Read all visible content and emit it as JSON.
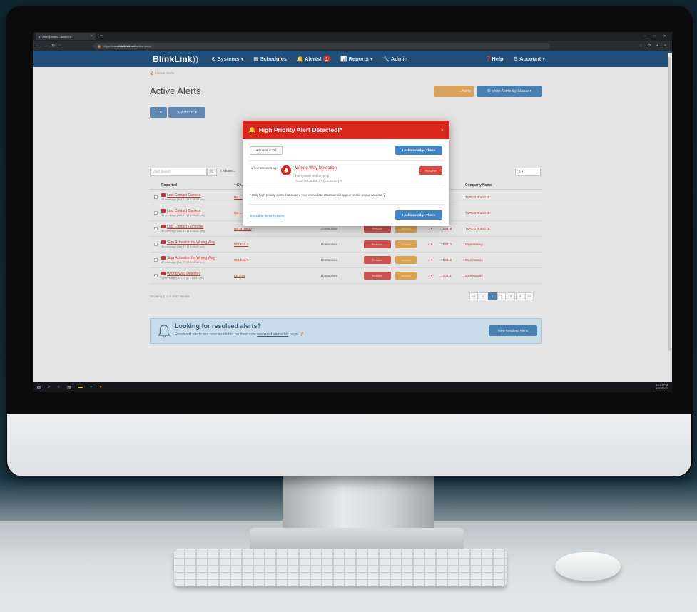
{
  "browser": {
    "tab_title": "Alert Details - BlinkLink",
    "tab_close": "×",
    "new_tab": "+",
    "url_prefix": "https://www.",
    "url_domain": "blinklink.net",
    "url_path": "/active-alerts"
  },
  "navbar": {
    "brand_bold": "BlinkLink",
    "brand_mark": "))",
    "items": {
      "systems": "⊙ Systems ▾",
      "schedules": "▦ Schedules",
      "alerts": "🔔 Alerts!",
      "alerts_badge": "1",
      "reports": "📊 Reports ▾",
      "admin": "🔧 Admin"
    },
    "help": "❓Help",
    "account": "⚙ Account ▾"
  },
  "page": {
    "breadcrumb": "🏠 / Active Alerts",
    "title": "Active Alerts",
    "btn_orange": "... Alerts",
    "btn_view_status": "☰ View Alerts by Status ▾",
    "btn_checkbox": "☐ ▾",
    "btn_actions": "✎ Actions ▾",
    "search_placeholder": "Alert Search",
    "search_icon": "🔍",
    "advanced": "T Advanc...",
    "per_page": "6   ▾"
  },
  "table": {
    "headers": {
      "reported": "Reported",
      "system": "▾ Sy...",
      "status": "",
      "actions": "",
      "priority": "",
      "id": "...t ID",
      "company": "Company Name"
    },
    "rows": [
      {
        "title": "Lost Contact Camera",
        "sub": "33 mins ago (Jun 27 @ 1:58:32 pm)",
        "system": "NB ...",
        "status": "",
        "priority": "",
        "id": "...54",
        "company": "TxPCO R and D"
      },
      {
        "title": "Lost Contact Camera",
        "sub": "35 mins ago (Jun 27 @ 1:56:22 pm)",
        "system": "NB ...",
        "status": "",
        "priority": "",
        "id": "...11",
        "company": "TxPCO R and D"
      },
      {
        "title": "Lost Contact Controller",
        "sub": "36 mins ago (Jun 27 @ 1:56:22 pm)",
        "system": "NB on ramp",
        "status": "Unresolved",
        "priority": "3 ▾",
        "id": "718616",
        "company": "TxPCO R and D"
      },
      {
        "title": "Sign Activation for Wrong Way",
        "sub": "45 mins ago (Jun 27 @ 1:46:20 pm)",
        "system": "WB Exit 7",
        "status": "Unresolved",
        "priority": "4 ▾",
        "id": "718912",
        "company": "Expressway"
      },
      {
        "title": "Sign Activation for Wrong Way",
        "sub": "47 mins ago (Jun 27 @ 1:41:36 pm)",
        "system": "WB Exit 7",
        "status": "Unresolved",
        "priority": "4 ▾",
        "id": "718912",
        "company": "Expressway"
      },
      {
        "title": "Wrong Way Detected",
        "sub": "1 hours ago (Jun 27 @ 1:14:41 pm)",
        "system": "EB Exit",
        "status": "Unresolved",
        "priority": "3 ▾",
        "id": "720411",
        "company": "Expressway"
      }
    ],
    "resolve_label": "Resolve",
    "archive_label": "Archive",
    "showing": "Showing 1 to 6 of 67 entries",
    "pager": [
      "<<",
      "<",
      "1",
      "2",
      "3",
      ">",
      ">>"
    ]
  },
  "resolved_banner": {
    "title": "Looking for resolved alerts?",
    "sub_before": "Resolved alerts are now available on their own ",
    "sub_link": "resolved alerts list",
    "sub_after": " page ❓",
    "button": "View Resolved Alerts"
  },
  "modal": {
    "title": "High Priority Alert Detected!*",
    "close": "×",
    "sound_btn": "◂ Sound is Off",
    "ack_btn": "I Acknowledge These",
    "alert_when": "a few seconds ago",
    "alert_title": "Wrong Way Detection",
    "alert_system": "For system WB on ramp",
    "alert_occurred": "Occurred at Jun 27 @ 2:28:54 pm",
    "resolve_btn": "Resolve",
    "note": "* Only high priority alerts that require your immediate attention will appear in this popup window ❓",
    "disable_link": "⊘Disable these Notices",
    "ack_btn_bottom": "I Acknowledge These"
  },
  "taskbar": {
    "time": "12:01 PM",
    "date": "4/20/2021"
  },
  "colors": {
    "navbar": "#1f4e79",
    "modal_header": "#d8261c",
    "primary_button": "#3f84c4"
  }
}
